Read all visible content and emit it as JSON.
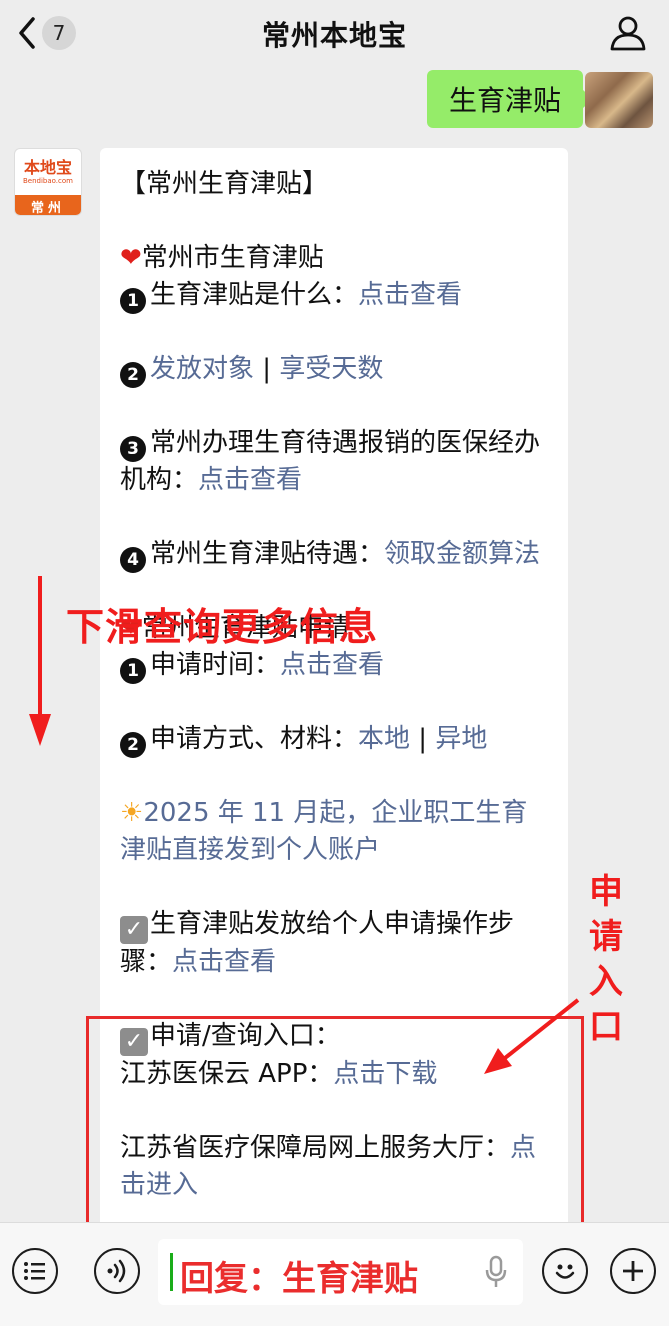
{
  "header": {
    "title": "常州本地宝",
    "unread_count": "7"
  },
  "outgoing": {
    "text": "生育津贴"
  },
  "bot": {
    "brand": "本地宝",
    "url": "Bendibao.com",
    "city": "常州"
  },
  "message": {
    "title": "【常州生育津贴】",
    "sec1_title": "常州市生育津贴",
    "item1_label": "生育津贴是什么：",
    "item1_link": "点击查看",
    "item2_link_a": "发放对象",
    "item2_sep": " | ",
    "item2_link_b": "享受天数",
    "item3_label": "常州办理生育待遇报销的医保经办机构：",
    "item3_link": "点击查看",
    "item4_label": "常州生育津贴待遇：",
    "item4_link": "领取金额算法",
    "sec2_title": "常州生育津贴申请",
    "apply1_label": "申请时间：",
    "apply1_link": "点击查看",
    "apply2_label": "申请方式、材料：",
    "apply2_link_a": "本地",
    "apply2_sep": " | ",
    "apply2_link_b": "异地",
    "notice_link": "2025 年 11 月起，企业职工生育津贴直接发到个人账户",
    "steps_label": "生育津贴发放给个人申请操作步骤：",
    "steps_link": "点击查看",
    "entry_label": "申请/查询入口：",
    "app_label": "江苏医保云 APP：",
    "app_link": "点击下载",
    "hall_label": "江苏省医疗保障局网上服务大厅：",
    "hall_link": "点击进入"
  },
  "annotations": {
    "scroll_hint": "下滑查询更多信息",
    "apply_entry": "申请入口",
    "color": "#f01d1d"
  },
  "input": {
    "text": "回复：生育津贴"
  },
  "icons": [
    "back-chevron-icon",
    "user-icon",
    "list-icon",
    "voice-icon",
    "mic-icon",
    "emoji-icon",
    "plus-icon"
  ],
  "colors": {
    "link": "#576b95",
    "bubble_green": "#95ec69",
    "background": "#ededed"
  }
}
